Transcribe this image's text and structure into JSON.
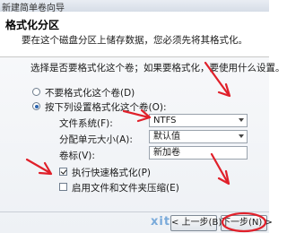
{
  "window": {
    "title": "新建简单卷向导"
  },
  "header": {
    "title": "格式化分区",
    "description": "要在这个磁盘分区上储存数据，您必须先将其格式化。"
  },
  "main": {
    "intro": "选择是否要格式化这个卷；如果要格式化，要使用什么设置。",
    "options": [
      {
        "label": "不要格式化这个卷(D)",
        "selected": false
      },
      {
        "label": "按下列设置格式化这个卷(O):",
        "selected": true
      }
    ],
    "settings": {
      "filesystem_label": "文件系统(F):",
      "filesystem_value": "NTFS",
      "allocation_label": "分配单元大小(A):",
      "allocation_value": "默认值",
      "volume_label": "卷标(V):",
      "volume_value": "新加卷"
    },
    "checkboxes": [
      {
        "label": "执行快速格式化(P)",
        "checked": true
      },
      {
        "label": "启用文件和文件夹压缩(E)",
        "checked": false
      }
    ]
  },
  "footer": {
    "back_label": "< 上一步(B)",
    "next_label": "下一步(N) >",
    "watermark": "xitong"
  },
  "colors": {
    "annotation": "#e0202a",
    "selection": "#2a64b0"
  }
}
